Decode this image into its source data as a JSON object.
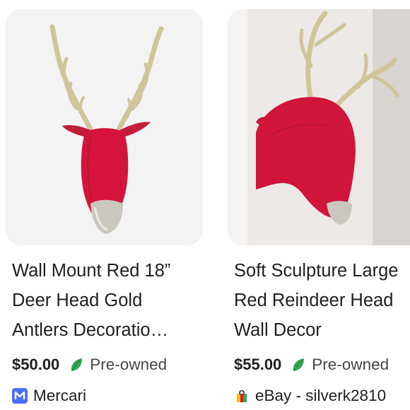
{
  "products": [
    {
      "image_icon": "red-deer-head-photo",
      "title_lines": [
        "Wall Mount Red 18”",
        "Deer Head Gold",
        "Antlers Decoratio…"
      ],
      "price": "$50.00",
      "condition_icon": "leaf-icon",
      "condition": "Pre-owned",
      "seller_icon": "mercari-logo",
      "seller": "Mercari",
      "colors": {
        "badge": "#4f6df5",
        "leaf": "#34a853"
      }
    },
    {
      "image_icon": "red-reindeer-head-photo",
      "title_lines": [
        "Soft Sculpture Large",
        "Red Reindeer Head",
        "Wall Decor"
      ],
      "price": "$55.00",
      "condition_icon": "leaf-icon",
      "condition": "Pre-owned",
      "seller_icon": "ebay-bag-icon",
      "seller": "eBay - silverk2810",
      "colors": {
        "badge": "#c5221f",
        "leaf": "#34a853"
      }
    }
  ]
}
